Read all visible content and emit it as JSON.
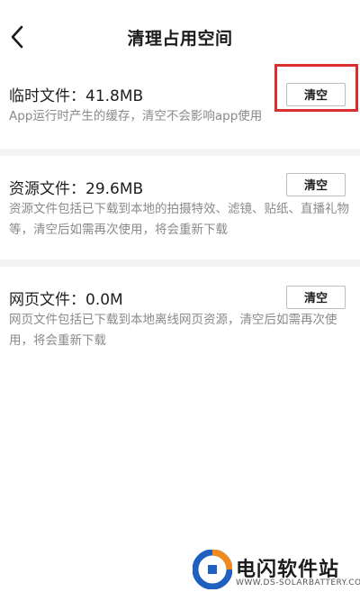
{
  "header": {
    "title": "清理占用空间",
    "back_icon": "chevron-left-icon"
  },
  "sections": [
    {
      "title": "临时文件：41.8MB",
      "description": "App运行时产生的缓存，清空不会影响app使用",
      "button_label": "清空"
    },
    {
      "title": "资源文件：29.6MB",
      "description": "资源文件包括已下载到本地的拍摄特效、滤镜、贴纸、直播礼物等，清空后如需再次使用，将会重新下载",
      "button_label": "清空"
    },
    {
      "title": "网页文件：0.0M",
      "description": "网页文件包括已下载到本地离线网页资源，清空后如需再次使用，将会重新下载",
      "button_label": "清空"
    }
  ],
  "annotation": {
    "highlight_color": "#d92f2f"
  },
  "watermark": {
    "name": "电闪软件站",
    "url": "WWW.DS-SOLARBATTERY.COM"
  },
  "colors": {
    "text": "#1e1e1e",
    "description": "#8a8a8a",
    "divider": "#f4f4f4",
    "logo_blue": "#1f5fbf",
    "logo_orange": "#f08a1c"
  }
}
